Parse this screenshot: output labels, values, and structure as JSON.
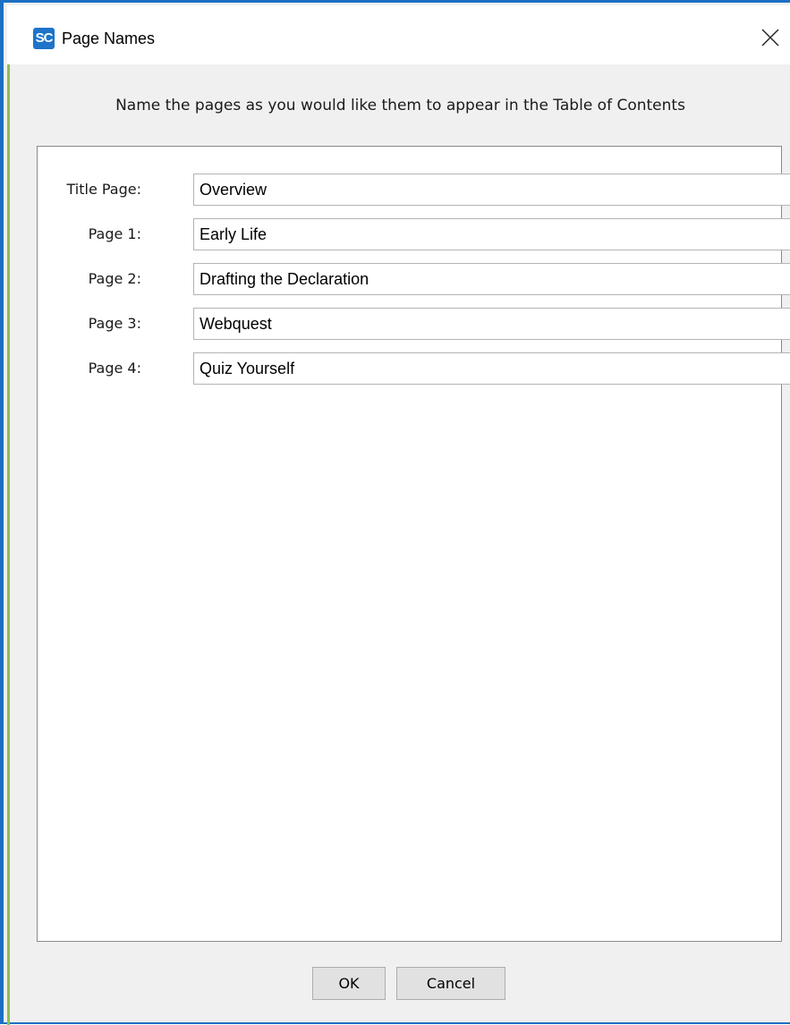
{
  "window": {
    "title": "Page Names",
    "icon_text": "SC",
    "icon": "sc-app-icon",
    "close_icon": "close-icon"
  },
  "instruction": "Name the pages as you would like them to appear in the Table of Contents",
  "pages": [
    {
      "label": "Title Page:",
      "value": "Overview"
    },
    {
      "label": "Page 1:",
      "value": "Early Life"
    },
    {
      "label": "Page 2:",
      "value": "Drafting the Declaration"
    },
    {
      "label": "Page 3:",
      "value": "Webquest"
    },
    {
      "label": "Page 4:",
      "value": "Quiz Yourself"
    }
  ],
  "buttons": {
    "ok": "OK",
    "cancel": "Cancel"
  },
  "colors": {
    "window_border": "#1d6fc4",
    "icon_bg": "#1d74c9",
    "dialog_bg": "#f0f0f0"
  }
}
